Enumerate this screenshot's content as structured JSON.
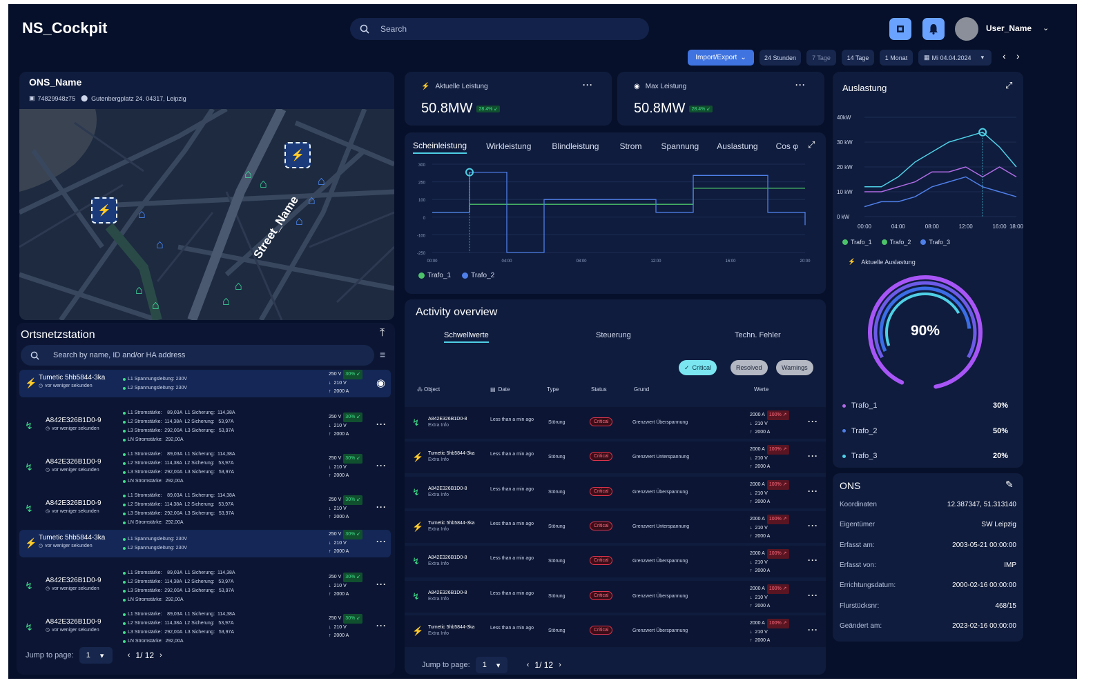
{
  "header": {
    "app_title": "NS_Cockpit",
    "search_placeholder": "Search",
    "user_name": "User_Name"
  },
  "toolbar": {
    "import_export": "Import/Export",
    "ranges": [
      "24 Stunden",
      "7 Tage",
      "14 Tage",
      "1 Monat"
    ],
    "date": "Mi 04.04.2024"
  },
  "station_card": {
    "name": "ONS_Name",
    "id": "74829948z75",
    "address": "Gutenbergplatz 24. 04317, Leipzig",
    "street_label": "Street_Name"
  },
  "kpis": [
    {
      "label": "Aktuelle Leistung",
      "value": "50.8MW",
      "badge": "28.4% ↙"
    },
    {
      "label": "Max Leistung",
      "value": "50.8MW",
      "badge": "28.4% ↙"
    }
  ],
  "main_chart": {
    "tabs": [
      "Scheinleistung",
      "Wirkleistung",
      "Blindleistung",
      "Strom",
      "Spannung",
      "Auslastung",
      "Cos φ"
    ],
    "legend": [
      "Trafo_1",
      "Trafo_2"
    ],
    "colors": {
      "trafo_1": "#4cc36a",
      "trafo_2": "#4f7fe8"
    }
  },
  "chart_data": [
    {
      "type": "line",
      "x": [
        "00:00",
        "02:00",
        "04:00",
        "06:00",
        "08:00",
        "10:00",
        "12:00",
        "14:00",
        "16:00",
        "18:00",
        "20:00"
      ],
      "xticks": [
        "00:00",
        "04:00",
        "08:00",
        "12:00",
        "16:00",
        "20:00"
      ],
      "yticks": [
        300,
        250,
        100,
        0,
        -100,
        -250
      ],
      "ylim": [
        -250,
        300
      ],
      "series": [
        {
          "name": "Trafo_1",
          "values": [
            0,
            50,
            50,
            50,
            50,
            50,
            50,
            150,
            150,
            150,
            150
          ]
        },
        {
          "name": "Trafo_2",
          "values": [
            0,
            250,
            -250,
            80,
            80,
            80,
            0,
            230,
            230,
            0,
            -80
          ]
        }
      ]
    },
    {
      "type": "line",
      "title": "Auslastung",
      "x": [
        "00:00",
        "02:00",
        "04:00",
        "06:00",
        "08:00",
        "10:00",
        "12:00",
        "14:00",
        "16:00",
        "18:00"
      ],
      "xticks": [
        "00:00",
        "04:00",
        "08:00",
        "12:00",
        "16:00",
        "18:00"
      ],
      "yticks": [
        "40kW",
        "30 kW",
        "20 kW",
        "10 kW",
        "0 kW"
      ],
      "ylim": [
        0,
        40
      ],
      "series": [
        {
          "name": "Trafo_1",
          "values": [
            12,
            12,
            16,
            22,
            26,
            30,
            32,
            34,
            28,
            20
          ]
        },
        {
          "name": "Trafo_2",
          "values": [
            10,
            10,
            12,
            14,
            18,
            18,
            20,
            16,
            20,
            16
          ]
        },
        {
          "name": "Trafo_3",
          "values": [
            4,
            6,
            6,
            8,
            12,
            14,
            16,
            12,
            10,
            8
          ]
        }
      ]
    }
  ],
  "auslastung": {
    "title": "Auslastung",
    "legend": [
      "Trafo_1",
      "Trafo_2",
      "Trafo_3"
    ],
    "current_label": "Aktuelle Auslastung",
    "gauge_value": "90%",
    "gauge_fraction": 0.9,
    "rows": [
      {
        "name": "Trafo_1",
        "value": "30%"
      },
      {
        "name": "Trafo_2",
        "value": "50%"
      },
      {
        "name": "Trafo_3",
        "value": "20%"
      }
    ],
    "colors": {
      "trafo_1": "#4cc36a",
      "trafo_2": "#b06be6",
      "trafo_3": "#4f7fe8"
    }
  },
  "ons_info": {
    "title": "ONS",
    "rows": [
      {
        "label": "Koordinaten",
        "value": "12.387347, 51.313140"
      },
      {
        "label": "Eigentümer",
        "value": "SW Leipzig"
      },
      {
        "label": "Erfasst am:",
        "value": "2003-05-21 00:00:00"
      },
      {
        "label": "Erfasst von:",
        "value": "IMP"
      },
      {
        "label": "Errichtungsdatum:",
        "value": "2000-02-16 00:00:00"
      },
      {
        "label": "Flurstücksnr:",
        "value": "468/15"
      },
      {
        "label": "Geändert am:",
        "value": "2023-02-16 00:00:00"
      }
    ]
  },
  "station_list": {
    "title": "Ortsnetzstation",
    "search_placeholder": "Search by name, ID and/or HA address",
    "page_label": "Jump to page:",
    "page_value": "1",
    "pagination": "1/ 12",
    "items": [
      {
        "name": "Tumetic 5hb5844-3ka",
        "time": "vor weniger sekunden",
        "lines": [
          "L1 Spannungsleitung: 230V",
          "L2 Spannungsleitung: 230V"
        ],
        "values": [
          "250 V",
          "210 V",
          "2000 A"
        ],
        "badge": "30% ↙",
        "highlight": true,
        "icon": "bolt",
        "action": "eye"
      },
      {
        "name": "A842E326B1D0-9",
        "time": "vor weniger sekunden",
        "lines": [
          "L1 Stromstärke:    89,03A  L1 Sicherung:  114,38A",
          "L2 Stromstärke:  114,38A  L2 Sicherung:   53,97A",
          "L3 Stromstärke:  292,00A  L3 Sicherung:   53,97A",
          "LN Stromstärke:  292,00A"
        ],
        "values": [
          "250 V",
          "210 V",
          "2000 A"
        ],
        "badge": "30% ↙",
        "highlight": false,
        "icon": "plug",
        "action": "dots"
      },
      {
        "name": "A842E326B1D0-9",
        "time": "vor weniger sekunden",
        "lines": [
          "L1 Stromstärke:    89,03A  L1 Sicherung:  114,38A",
          "L2 Stromstärke:  114,38A  L2 Sicherung:   53,97A",
          "L3 Stromstärke:  292,00A  L3 Sicherung:   53,97A",
          "LN Stromstärke:  292,00A"
        ],
        "values": [
          "250 V",
          "210 V",
          "2000 A"
        ],
        "badge": "30% ↙",
        "highlight": false,
        "icon": "plug",
        "action": "dots"
      },
      {
        "name": "A842E326B1D0-9",
        "time": "vor weniger sekunden",
        "lines": [
          "L1 Stromstärke:    89,03A  L1 Sicherung:  114,38A",
          "L2 Stromstärke:  114,38A  L2 Sicherung:   53,97A",
          "L3 Stromstärke:  292,00A  L3 Sicherung:   53,97A",
          "LN Stromstärke:  292,00A"
        ],
        "values": [
          "250 V",
          "210 V",
          "2000 A"
        ],
        "badge": "30% ↙",
        "highlight": false,
        "icon": "plug",
        "action": "dots"
      },
      {
        "name": "Tumetic 5hb5844-3ka",
        "time": "vor weniger sekunden",
        "lines": [
          "L1 Spannungsleitung: 230V",
          "L2 Spannungsleitung: 230V"
        ],
        "values": [
          "250 V",
          "210 V",
          "2000 A"
        ],
        "badge": "30% ↙",
        "highlight": true,
        "icon": "bolt-red",
        "action": "dots"
      },
      {
        "name": "A842E326B1D0-9",
        "time": "vor weniger sekunden",
        "lines": [
          "L1 Stromstärke:    89,03A  L1 Sicherung:  114,38A",
          "L2 Stromstärke:  114,38A  L2 Sicherung:   53,97A",
          "L3 Stromstärke:  292,00A  L3 Sicherung:   53,97A",
          "LN Stromstärke:  292,00A"
        ],
        "values": [
          "250 V",
          "210 V",
          "2000 A"
        ],
        "badge": "30% ↙",
        "highlight": false,
        "icon": "plug",
        "action": "dots"
      },
      {
        "name": "A842E326B1D0-9",
        "time": "vor weniger sekunden",
        "lines": [
          "L1 Stromstärke:    89,03A  L1 Sicherung:  114,38A",
          "L2 Stromstärke:  114,38A  L2 Sicherung:   53,97A",
          "L3 Stromstärke:  292,00A  L3 Sicherung:   53,97A",
          "LN Stromstärke:  292,00A"
        ],
        "values": [
          "250 V",
          "210 V",
          "2000 A"
        ],
        "badge": "30% ↙",
        "highlight": false,
        "icon": "plug",
        "action": "dots"
      }
    ]
  },
  "activity": {
    "title": "Activity overview",
    "tabs": [
      "Schwellwerte",
      "Steuerung",
      "Techn. Fehler"
    ],
    "filters": [
      "Critical",
      "Resolved",
      "Warnings"
    ],
    "columns": [
      "Object",
      "Date",
      "Type",
      "Status",
      "Grund",
      "Werte"
    ],
    "page_label": "Jump to page:",
    "page_value": "1",
    "pagination": "1/ 12",
    "rows": [
      {
        "object": "A842E326B1D0-8",
        "extra": "Extra Info",
        "date": "Less than a min ago",
        "type": "Störung",
        "status": "Critical",
        "grund": "Grenzwert Überspannung",
        "values": [
          "2000 A",
          "210 V",
          "2000 A"
        ],
        "badge": "100% ↗",
        "icon": "plug"
      },
      {
        "object": "Tumetic 5hb5844-3ka",
        "extra": "Extra Info",
        "date": "Less than a min ago",
        "type": "Störung",
        "status": "Critical",
        "grund": "Grenzwert Unterspannung",
        "values": [
          "2000 A",
          "210 V",
          "2000 A"
        ],
        "badge": "100% ↗",
        "icon": "bolt"
      },
      {
        "object": "A842E326B1D0-8",
        "extra": "Extra Info",
        "date": "Less than a min ago",
        "type": "Störung",
        "status": "Critical",
        "grund": "Grenzwert Überspannung",
        "values": [
          "2000 A",
          "210 V",
          "2000 A"
        ],
        "badge": "100% ↗",
        "icon": "plug"
      },
      {
        "object": "Tumetic 5hb5844-3ka",
        "extra": "Extra Info",
        "date": "Less than a min ago",
        "type": "Störung",
        "status": "Critical",
        "grund": "Grenzwert Unterspannung",
        "values": [
          "2000 A",
          "210 V",
          "2000 A"
        ],
        "badge": "100% ↗",
        "icon": "bolt"
      },
      {
        "object": "A842E326B1D0-8",
        "extra": "Extra Info",
        "date": "Less than a min ago",
        "type": "Störung",
        "status": "Critical",
        "grund": "Grenzwert Überspannung",
        "values": [
          "2000 A",
          "210 V",
          "2000 A"
        ],
        "badge": "100% ↗",
        "icon": "plug"
      },
      {
        "object": "A842E326B1D0-8",
        "extra": "Extra Info",
        "date": "Less than a min ago",
        "type": "Störung",
        "status": "Critical",
        "grund": "Grenzwert Überspannung",
        "values": [
          "2000 A",
          "210 V",
          "2000 A"
        ],
        "badge": "100% ↗",
        "icon": "plug"
      },
      {
        "object": "Tumetic 5hb5844-3ka",
        "extra": "Extra Info",
        "date": "Less than a min ago",
        "type": "Störung",
        "status": "Critical",
        "grund": "Grenzwert Überspannung",
        "values": [
          "2000 A",
          "210 V",
          "2000 A"
        ],
        "badge": "100% ↗",
        "icon": "bolt"
      }
    ]
  }
}
